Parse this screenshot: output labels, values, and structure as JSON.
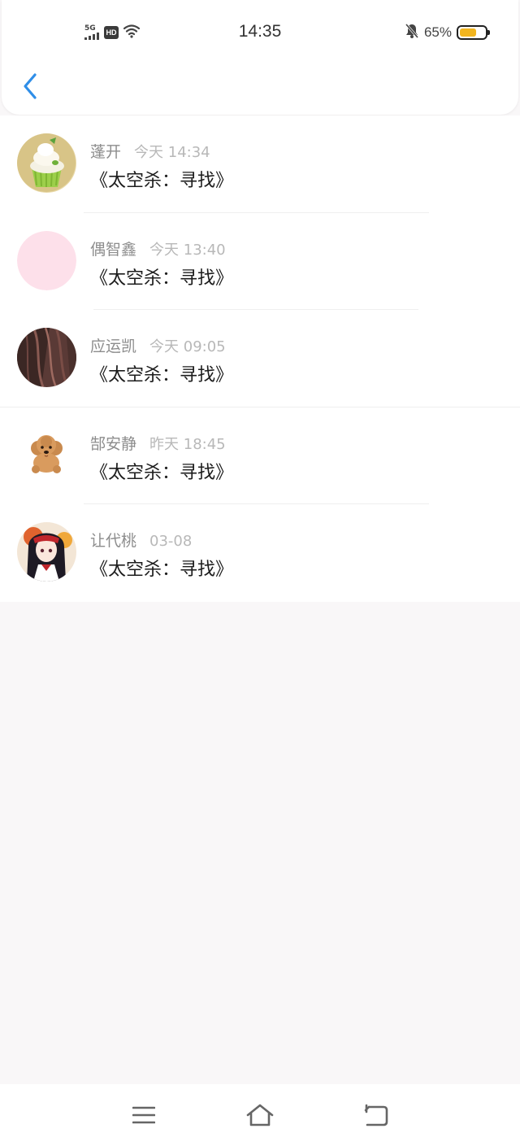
{
  "status_bar": {
    "network": "5G",
    "hd_badge": "HD",
    "time": "14:35",
    "battery_percent": "65%",
    "battery_level": 0.65,
    "icons": [
      "signal-icon",
      "hd-icon",
      "wifi-icon",
      "mute-bell-icon",
      "battery-icon"
    ]
  },
  "nav": {
    "back_icon": "chevron-left-icon"
  },
  "colors": {
    "accent": "#2f8ee8",
    "battery": "#f2b51f",
    "background": "#f9f7f8"
  },
  "messages": [
    {
      "name": "蓬开",
      "time": "今天 14:34",
      "text": "《太空杀：寻找》",
      "avatar": "cupcake-avatar"
    },
    {
      "name": "偶智鑫",
      "time": "今天 13:40",
      "text": "《太空杀：寻找》",
      "avatar": "pink-avatar"
    },
    {
      "name": "应运凯",
      "time": "今天 09:05",
      "text": "《太空杀：寻找》",
      "avatar": "hair-photo-avatar"
    },
    {
      "name": "郜安静",
      "time": "昨天 18:45",
      "text": "《太空杀：寻找》",
      "avatar": "poodle-avatar"
    },
    {
      "name": "让代桃",
      "time": "03-08",
      "text": "《太空杀：寻找》",
      "avatar": "anime-girl-avatar"
    }
  ],
  "bottom_nav": {
    "icons": [
      "menu-icon",
      "home-icon",
      "back-return-icon"
    ]
  }
}
